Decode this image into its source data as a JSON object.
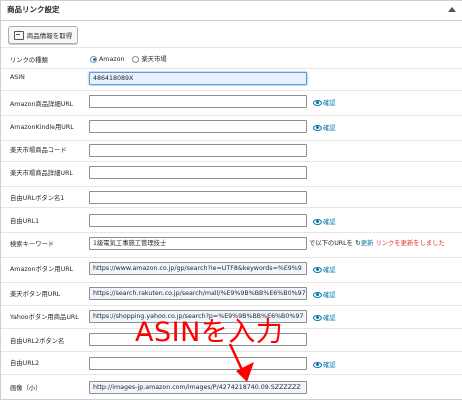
{
  "panel": {
    "title": "商品リンク設定"
  },
  "fetch_button": {
    "label": "商品情報を取得"
  },
  "link_type": {
    "label": "リンクの種類",
    "options": [
      {
        "label": "Amazon",
        "checked": true
      },
      {
        "label": "楽天市場",
        "checked": false
      }
    ]
  },
  "confirm_label": "確認",
  "fields": {
    "asin": {
      "label": "ASIN",
      "value": "486418089X"
    },
    "amazon_detail_url": {
      "label": "Amazon商品詳細URL",
      "value": ""
    },
    "amazon_kindle_url": {
      "label": "AmazonKindle用URL",
      "value": ""
    },
    "rakuten_code": {
      "label": "楽天市場商品コード",
      "value": ""
    },
    "rakuten_detail_url": {
      "label": "楽天市場商品詳細URL",
      "value": ""
    },
    "free_url_button1": {
      "label": "自由URLボタン名1",
      "value": ""
    },
    "free_url1": {
      "label": "自由URL1",
      "value": ""
    },
    "search_keyword": {
      "label": "検索キーワード",
      "value": "1級電気工事施工管理技士"
    },
    "amazon_button_url": {
      "label": "Amazonボタン用URL",
      "value": "https://www.amazon.co.jp/gp/search?ie=UTF8&keywords=%E9%9"
    },
    "rakuten_button_url": {
      "label": "楽天ボタン用URL",
      "value": "https://search.rakuten.co.jp/search/mall/%E9%9B%BB%E6%B0%97"
    },
    "yahoo_button_url": {
      "label": "Yahooボタン用商品URL",
      "value": "https://shopping.yahoo.co.jp/search?p=%E9%9B%BB%E6%B0%97"
    },
    "free_url_button2": {
      "label": "自由URL2ボタン名",
      "value": ""
    },
    "free_url2": {
      "label": "自由URL2",
      "value": ""
    },
    "image_small": {
      "label": "画像（小）",
      "value": "http://images-jp.amazon.com/images/P/4274218740.09.SZZZZZZ"
    }
  },
  "keyword_refresh": {
    "prefix": "で以下のURLを",
    "link": "更新",
    "message": "リンクを更新をしました"
  },
  "annotation": {
    "text": "ASINを入力",
    "color": "#ff0000"
  }
}
